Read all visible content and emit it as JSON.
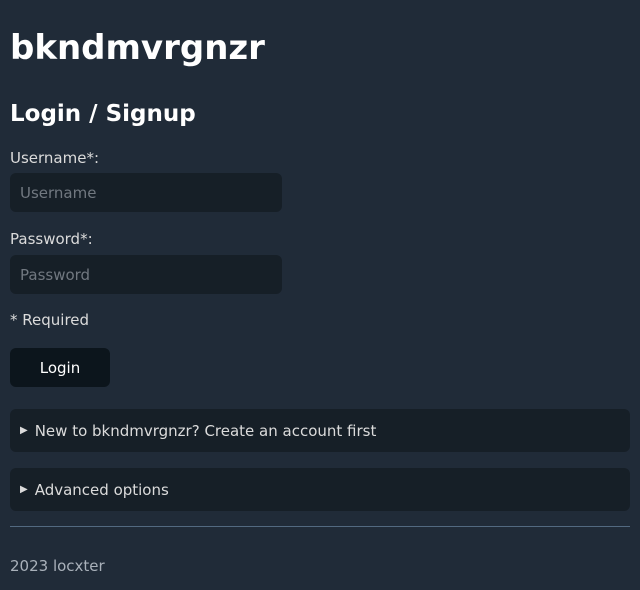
{
  "app": {
    "title": "bkndmvrgnzr"
  },
  "login": {
    "heading": "Login / Signup",
    "username_label": "Username*:",
    "username_placeholder": "Username",
    "password_label": "Password*:",
    "password_placeholder": "Password",
    "required_note": "* Required",
    "login_button": "Login"
  },
  "details": {
    "create_account": "New to bkndmvrgnzr? Create an account first",
    "advanced_options": "Advanced options",
    "disclosure_icon": "triangle-right-icon"
  },
  "footer": {
    "text": "2023 locxter"
  },
  "colors": {
    "background": "#202b38",
    "input_background": "#161f27",
    "button_background": "#0c151c",
    "text": "#dbdbdb",
    "heading": "#ffffff"
  }
}
